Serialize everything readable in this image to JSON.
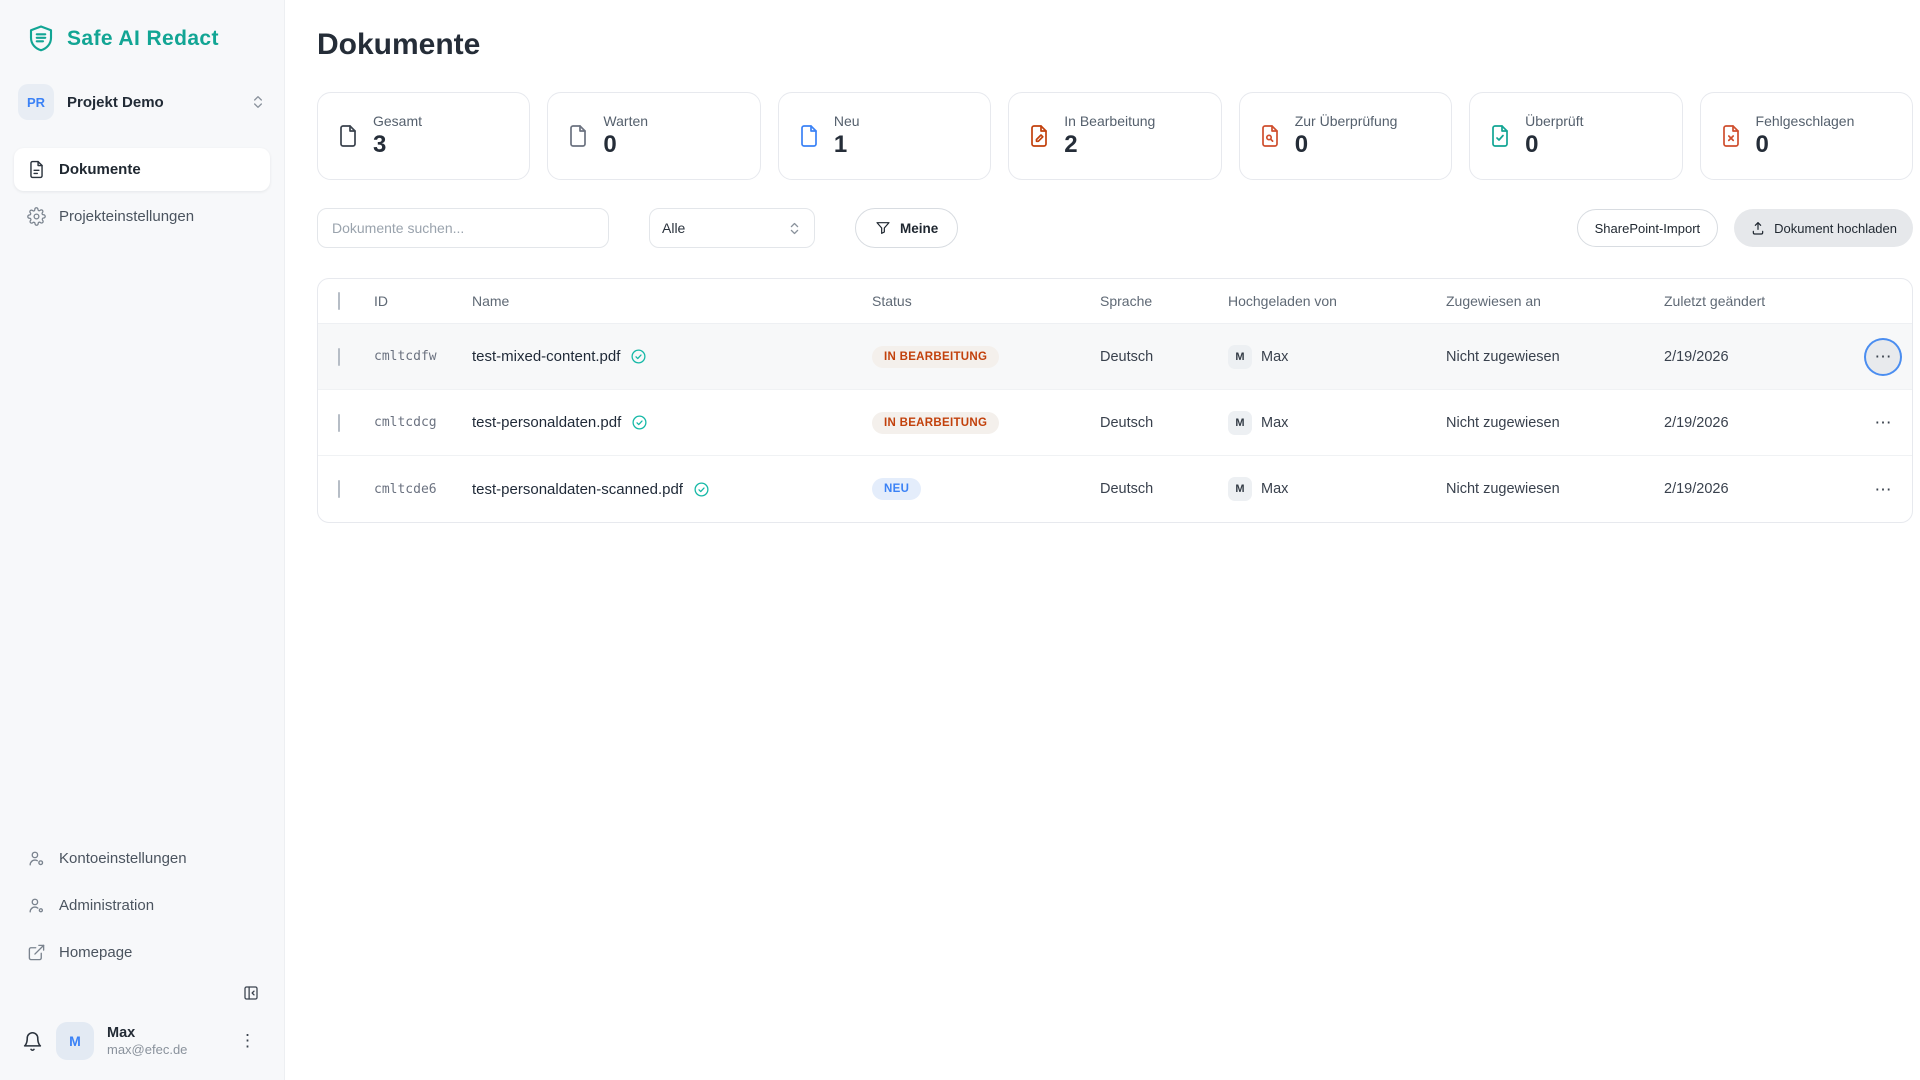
{
  "app": {
    "name": "Safe AI Redact"
  },
  "colors": {
    "brand_teal": "#12a594",
    "accent_blue": "#3b82f6",
    "status_in_progress_text": "#c2410c",
    "status_in_progress_bg": "#f4f0ec",
    "status_new_text": "#3b82f6",
    "status_new_bg": "#e4edfb",
    "stat_icon_orange": "#c2410c",
    "stat_icon_red": "#cf4f2e",
    "stat_icon_teal": "#12a594"
  },
  "icons": {
    "ellipsis": "⋯",
    "kebab": "⋮"
  },
  "sidebar": {
    "project": {
      "initials": "PR",
      "name": "Projekt Demo"
    },
    "nav": [
      {
        "label": "Dokumente"
      },
      {
        "label": "Projekteinstellungen"
      }
    ],
    "footer_nav": [
      {
        "label": "Kontoeinstellungen"
      },
      {
        "label": "Administration"
      },
      {
        "label": "Homepage"
      }
    ],
    "user": {
      "initial": "M",
      "name": "Max",
      "email": "max@efec.de"
    }
  },
  "main": {
    "title": "Dokumente",
    "stats": [
      {
        "label": "Gesamt",
        "value": "3"
      },
      {
        "label": "Warten",
        "value": "0"
      },
      {
        "label": "Neu",
        "value": "1"
      },
      {
        "label": "In Bearbeitung",
        "value": "2"
      },
      {
        "label": "Zur Überprüfung",
        "value": "0"
      },
      {
        "label": "Überprüft",
        "value": "0"
      },
      {
        "label": "Fehlgeschlagen",
        "value": "0"
      }
    ],
    "toolbar": {
      "search_placeholder": "Dokumente suchen...",
      "filter_value": "Alle",
      "mine_label": "Meine",
      "sharepoint_label": "SharePoint-Import",
      "upload_label": "Dokument hochladen"
    },
    "table": {
      "columns": {
        "id": "ID",
        "name": "Name",
        "status": "Status",
        "sprache": "Sprache",
        "hochgeladen": "Hochgeladen von",
        "zugewiesen": "Zugewiesen an",
        "zuletzt": "Zuletzt geändert"
      },
      "rows": [
        {
          "id": "cmltcdfw",
          "name": "test-mixed-content.pdf",
          "status": "IN BEARBEITUNG",
          "sprache": "Deutsch",
          "uploader_initial": "M",
          "uploader": "Max",
          "assigned": "Nicht zugewiesen",
          "modified": "2/19/2026"
        },
        {
          "id": "cmltcdcg",
          "name": "test-personaldaten.pdf",
          "status": "IN BEARBEITUNG",
          "sprache": "Deutsch",
          "uploader_initial": "M",
          "uploader": "Max",
          "assigned": "Nicht zugewiesen",
          "modified": "2/19/2026"
        },
        {
          "id": "cmltcde6",
          "name": "test-personaldaten-scanned.pdf",
          "status": "NEU",
          "sprache": "Deutsch",
          "uploader_initial": "M",
          "uploader": "Max",
          "assigned": "Nicht zugewiesen",
          "modified": "2/19/2026"
        }
      ]
    }
  }
}
